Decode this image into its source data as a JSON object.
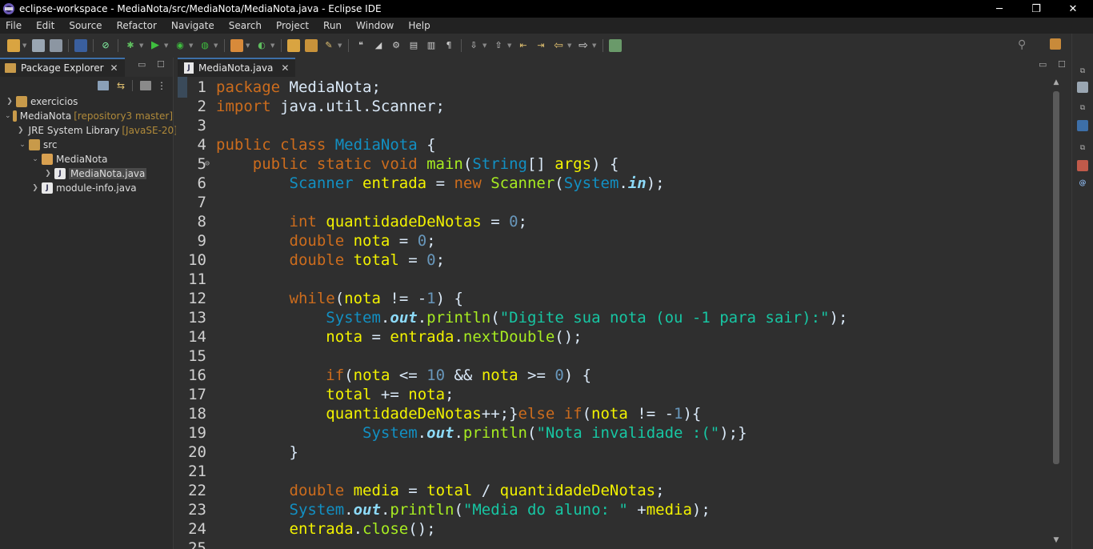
{
  "window": {
    "title": "eclipse-workspace - MediaNota/src/MediaNota/MediaNota.java - Eclipse IDE",
    "minimize": "─",
    "restore": "❐",
    "close": "✕"
  },
  "menu": [
    "File",
    "Edit",
    "Source",
    "Refactor",
    "Navigate",
    "Search",
    "Project",
    "Run",
    "Window",
    "Help"
  ],
  "package_explorer": {
    "tab_label": "Package Explorer",
    "tree": [
      {
        "label": "exercicios",
        "deco": "",
        "depth": 0,
        "expanded": false
      },
      {
        "label": "MediaNota",
        "deco": "[repository3 master]",
        "depth": 0,
        "expanded": true
      },
      {
        "label": "JRE System Library",
        "deco": "[JavaSE-20]",
        "depth": 1,
        "expanded": false
      },
      {
        "label": "src",
        "deco": "",
        "depth": 1,
        "expanded": true
      },
      {
        "label": "MediaNota",
        "deco": "",
        "depth": 2,
        "expanded": true
      },
      {
        "label": "MediaNota.java",
        "deco": "",
        "depth": 3,
        "expanded": false,
        "selected": true
      },
      {
        "label": "module-info.java",
        "deco": "",
        "depth": 2,
        "expanded": false
      }
    ]
  },
  "editor": {
    "tab_label": "MediaNota.java",
    "lines": [
      {
        "n": "1",
        "t": [
          [
            "kw",
            "package"
          ],
          [
            "plain",
            " MediaNota;"
          ]
        ]
      },
      {
        "n": "2",
        "t": [
          [
            "kw",
            "import"
          ],
          [
            "plain",
            " java.util.Scanner;"
          ]
        ]
      },
      {
        "n": "3",
        "t": []
      },
      {
        "n": "4",
        "t": [
          [
            "kw",
            "public class "
          ],
          [
            "cls",
            "MediaNota"
          ],
          [
            "plain",
            " {"
          ]
        ]
      },
      {
        "n": "5",
        "t": [
          [
            "plain",
            "    "
          ],
          [
            "kw",
            "public static void "
          ],
          [
            "mth",
            "main"
          ],
          [
            "plain",
            "("
          ],
          [
            "cls",
            "String"
          ],
          [
            "plain",
            "[] "
          ],
          [
            "var",
            "args"
          ],
          [
            "plain",
            ") {"
          ]
        ]
      },
      {
        "n": "6",
        "t": [
          [
            "plain",
            "        "
          ],
          [
            "cls",
            "Scanner"
          ],
          [
            "plain",
            " "
          ],
          [
            "var",
            "entrada"
          ],
          [
            "plain",
            " = "
          ],
          [
            "kw",
            "new "
          ],
          [
            "mth",
            "Scanner"
          ],
          [
            "plain",
            "("
          ],
          [
            "cls",
            "System"
          ],
          [
            "plain",
            "."
          ],
          [
            "fld",
            "in"
          ],
          [
            "plain",
            ");"
          ]
        ]
      },
      {
        "n": "7",
        "t": []
      },
      {
        "n": "8",
        "t": [
          [
            "plain",
            "        "
          ],
          [
            "kw",
            "int "
          ],
          [
            "var",
            "quantidadeDeNotas"
          ],
          [
            "plain",
            " = "
          ],
          [
            "num",
            "0"
          ],
          [
            "plain",
            ";"
          ]
        ]
      },
      {
        "n": "9",
        "t": [
          [
            "plain",
            "        "
          ],
          [
            "kw",
            "double "
          ],
          [
            "var",
            "nota"
          ],
          [
            "plain",
            " = "
          ],
          [
            "num",
            "0"
          ],
          [
            "plain",
            ";"
          ]
        ]
      },
      {
        "n": "10",
        "t": [
          [
            "plain",
            "        "
          ],
          [
            "kw",
            "double "
          ],
          [
            "var",
            "total"
          ],
          [
            "plain",
            " = "
          ],
          [
            "num",
            "0"
          ],
          [
            "plain",
            ";"
          ]
        ]
      },
      {
        "n": "11",
        "t": []
      },
      {
        "n": "12",
        "t": [
          [
            "plain",
            "        "
          ],
          [
            "kw",
            "while"
          ],
          [
            "plain",
            "("
          ],
          [
            "var",
            "nota"
          ],
          [
            "plain",
            " != -"
          ],
          [
            "num",
            "1"
          ],
          [
            "plain",
            ") {"
          ]
        ]
      },
      {
        "n": "13",
        "t": [
          [
            "plain",
            "            "
          ],
          [
            "cls",
            "System"
          ],
          [
            "plain",
            "."
          ],
          [
            "fld",
            "out"
          ],
          [
            "plain",
            "."
          ],
          [
            "mth",
            "println"
          ],
          [
            "plain",
            "("
          ],
          [
            "str",
            "\"Digite sua nota (ou -1 para sair):\""
          ],
          [
            "plain",
            ");"
          ]
        ]
      },
      {
        "n": "14",
        "t": [
          [
            "plain",
            "            "
          ],
          [
            "var",
            "nota"
          ],
          [
            "plain",
            " = "
          ],
          [
            "var",
            "entrada"
          ],
          [
            "plain",
            "."
          ],
          [
            "mth",
            "nextDouble"
          ],
          [
            "plain",
            "();"
          ]
        ]
      },
      {
        "n": "15",
        "t": []
      },
      {
        "n": "16",
        "t": [
          [
            "plain",
            "            "
          ],
          [
            "kw",
            "if"
          ],
          [
            "plain",
            "("
          ],
          [
            "var",
            "nota"
          ],
          [
            "plain",
            " <= "
          ],
          [
            "num",
            "10"
          ],
          [
            "plain",
            " && "
          ],
          [
            "var",
            "nota"
          ],
          [
            "plain",
            " >= "
          ],
          [
            "num",
            "0"
          ],
          [
            "plain",
            ") {"
          ]
        ]
      },
      {
        "n": "17",
        "t": [
          [
            "plain",
            "            "
          ],
          [
            "var",
            "total"
          ],
          [
            "plain",
            " += "
          ],
          [
            "var",
            "nota"
          ],
          [
            "plain",
            ";"
          ]
        ]
      },
      {
        "n": "18",
        "t": [
          [
            "plain",
            "            "
          ],
          [
            "var",
            "quantidadeDeNotas"
          ],
          [
            "plain",
            "++;}"
          ],
          [
            "kw",
            "else if"
          ],
          [
            "plain",
            "("
          ],
          [
            "var",
            "nota"
          ],
          [
            "plain",
            " != -"
          ],
          [
            "num",
            "1"
          ],
          [
            "plain",
            "){"
          ]
        ]
      },
      {
        "n": "19",
        "t": [
          [
            "plain",
            "                "
          ],
          [
            "cls",
            "System"
          ],
          [
            "plain",
            "."
          ],
          [
            "fld",
            "out"
          ],
          [
            "plain",
            "."
          ],
          [
            "mth",
            "println"
          ],
          [
            "plain",
            "("
          ],
          [
            "str",
            "\"Nota invalidade :(\""
          ],
          [
            "plain",
            ");}"
          ]
        ]
      },
      {
        "n": "20",
        "t": [
          [
            "plain",
            "        }"
          ]
        ]
      },
      {
        "n": "21",
        "t": []
      },
      {
        "n": "22",
        "t": [
          [
            "plain",
            "        "
          ],
          [
            "kw",
            "double "
          ],
          [
            "var",
            "media"
          ],
          [
            "plain",
            " = "
          ],
          [
            "var",
            "total"
          ],
          [
            "plain",
            " / "
          ],
          [
            "var",
            "quantidadeDeNotas"
          ],
          [
            "plain",
            ";"
          ]
        ]
      },
      {
        "n": "23",
        "t": [
          [
            "plain",
            "        "
          ],
          [
            "cls",
            "System"
          ],
          [
            "plain",
            "."
          ],
          [
            "fld",
            "out"
          ],
          [
            "plain",
            "."
          ],
          [
            "mth",
            "println"
          ],
          [
            "plain",
            "("
          ],
          [
            "str",
            "\"Media do aluno: \""
          ],
          [
            "plain",
            " +"
          ],
          [
            "var",
            "media"
          ],
          [
            "plain",
            ");"
          ]
        ]
      },
      {
        "n": "24",
        "t": [
          [
            "plain",
            "        "
          ],
          [
            "var",
            "entrada"
          ],
          [
            "plain",
            "."
          ],
          [
            "mth",
            "close"
          ],
          [
            "plain",
            "();"
          ]
        ]
      },
      {
        "n": "25",
        "t": []
      }
    ]
  },
  "colors": {
    "keyword": "#cc6c1d",
    "class": "#1290c3",
    "variable": "#f2f200",
    "method": "#a7ec21",
    "string": "#17c6a3",
    "number": "#6897bb",
    "field": "#8ddaf8"
  }
}
